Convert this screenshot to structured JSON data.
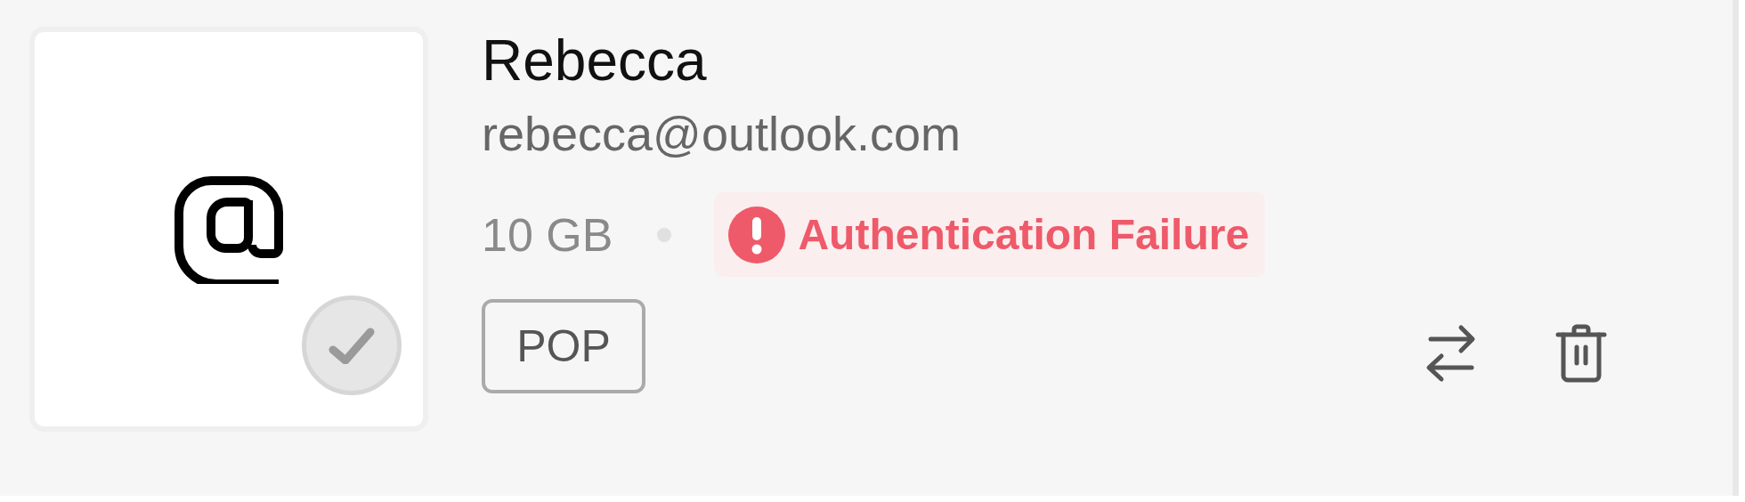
{
  "account": {
    "name": "Rebecca",
    "email": "rebecca@outlook.com",
    "storage": "10 GB",
    "default": false,
    "status": {
      "kind": "error",
      "text": "Authentication Failure"
    },
    "protocol": "POP"
  }
}
